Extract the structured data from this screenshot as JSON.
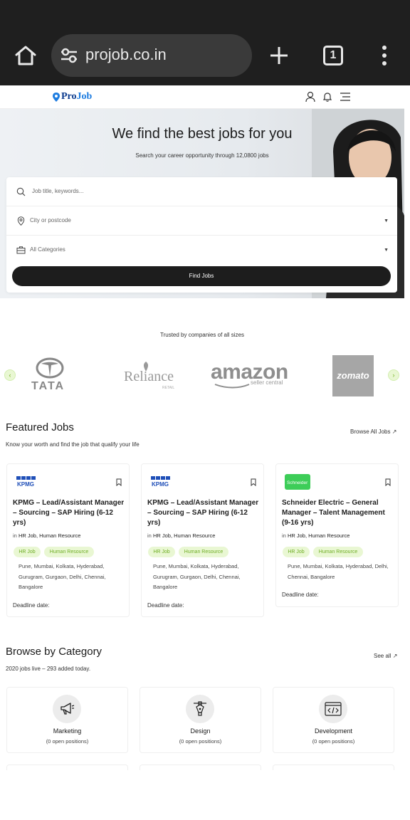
{
  "browser": {
    "url": "projob.co.in",
    "tab_count": "1",
    "icons": [
      "home-icon",
      "site-settings-icon",
      "new-tab-icon",
      "tab-switcher-icon",
      "more-menu-icon"
    ]
  },
  "header": {
    "logo_pro": "Pro",
    "logo_job": "Job",
    "icons": [
      "user-icon",
      "bell-icon",
      "hamburger-menu-icon"
    ]
  },
  "hero": {
    "title": "We find the best jobs for you",
    "subtitle": "Search your career opportunity through 12,0800 jobs",
    "keyword_placeholder": "Job title, keywords...",
    "location_placeholder": "City or postcode",
    "category_value": "All Categories",
    "find_button": "Find Jobs"
  },
  "trusted": {
    "text": "Trusted by companies of all sizes",
    "brands": {
      "tata": "TATA",
      "reliance": "Reliance",
      "reliance_sub": "RETAIL",
      "amazon": "amazon",
      "amazon_sub": "seller central",
      "zomato": "zomato"
    }
  },
  "featured": {
    "title": "Featured Jobs",
    "subtitle": "Know your worth and find the job that qualify your life",
    "browse_link": "Browse All Jobs",
    "jobs": [
      {
        "company_logo": "KPMG",
        "title": "KPMG – Lead/Assistant Manager – Sourcing – SAP Hiring (6-12 yrs)",
        "in_label": "in",
        "categories": "HR Job, Human Resource",
        "tags": [
          "HR Job",
          "Human Resource"
        ],
        "location": "Pune, Mumbai, Kolkata, Hyderabad, Gurugram, Gurgaon, Delhi, Chennai, Bangalore",
        "deadline": "Deadline date:"
      },
      {
        "company_logo": "KPMG",
        "title": "KPMG – Lead/Assistant Manager – Sourcing – SAP Hiring (6-12 yrs)",
        "in_label": "in",
        "categories": "HR Job, Human Resource",
        "tags": [
          "HR Job",
          "Human Resource"
        ],
        "location": "Pune, Mumbai, Kolkata, Hyderabad, Gurugram, Gurgaon, Delhi, Chennai, Bangalore",
        "deadline": "Deadline date:"
      },
      {
        "company_logo": "Schneider",
        "title": "Schneider Electric – General Manager – Talent Management (9-16 yrs)",
        "in_label": "in",
        "categories": "HR Job, Human Resource",
        "tags": [
          "HR Job",
          "Human Resource"
        ],
        "location": "Pune, Mumbai, Kolkata, Hyderabad, Delhi, Chennai, Bangalore",
        "deadline": "Deadline date:"
      }
    ]
  },
  "categories": {
    "title": "Browse by Category",
    "subtitle": "2020 jobs live – 293 added today.",
    "see_all": "See all",
    "items": [
      {
        "name": "Marketing",
        "count": "(0 open positions)",
        "icon": "megaphone-icon"
      },
      {
        "name": "Design",
        "count": "(0 open positions)",
        "icon": "design-pen-icon"
      },
      {
        "name": "Development",
        "count": "(0 open positions)",
        "icon": "code-window-icon"
      }
    ]
  },
  "colors": {
    "chrome_bg": "#1f1f1f",
    "button_dark": "#1d1d1d",
    "tag_bg": "#e9f7d3",
    "tag_text": "#6fae25",
    "logo_blue": "#0b3a8d"
  }
}
